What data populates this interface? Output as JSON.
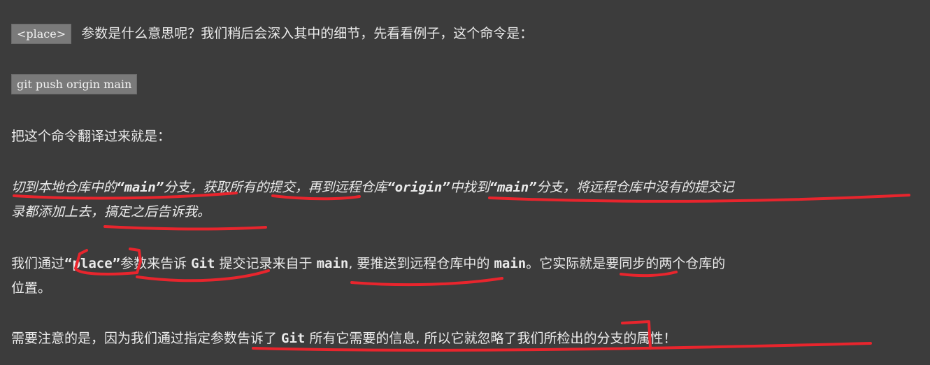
{
  "para1": {
    "chip": "<place>",
    "text": "参数是什么意思呢？我们稍后会深入其中的细节，先看看例子，这个命令是："
  },
  "command": {
    "text": "git push origin main"
  },
  "para2": {
    "text": "把这个命令翻译过来就是："
  },
  "para3": {
    "line1_a": "切到本地仓库中的",
    "line1_b": "“main”",
    "line1_c": "分支，获取所有的提交，再到远程仓库",
    "line1_d": "“origin”",
    "line1_e": "中找到",
    "line1_f": "“main”",
    "line1_g": "分支，将远程仓库中没有的提交记",
    "line2": "录都添加上去，搞定之后告诉我。"
  },
  "para4": {
    "t1": "我们通过",
    "t2": "“place”",
    "t3": "参数来告诉 ",
    "t4": "Git",
    "t5": " 提交记录来自于 ",
    "t6": "main",
    "t7": ", 要推送到远程仓库中的 ",
    "t8": "main",
    "t9": "。它实际就是要同步的两个仓库的",
    "line2": "位置。"
  },
  "para5": {
    "t1": "需要注意的是，因为我们通过指定参数告诉了 ",
    "t2": "Git",
    "t3": " 所有它需要的信息, 所以它就忽略了我们所检出的分支的属性！"
  },
  "annotation_color": "#e8252d"
}
